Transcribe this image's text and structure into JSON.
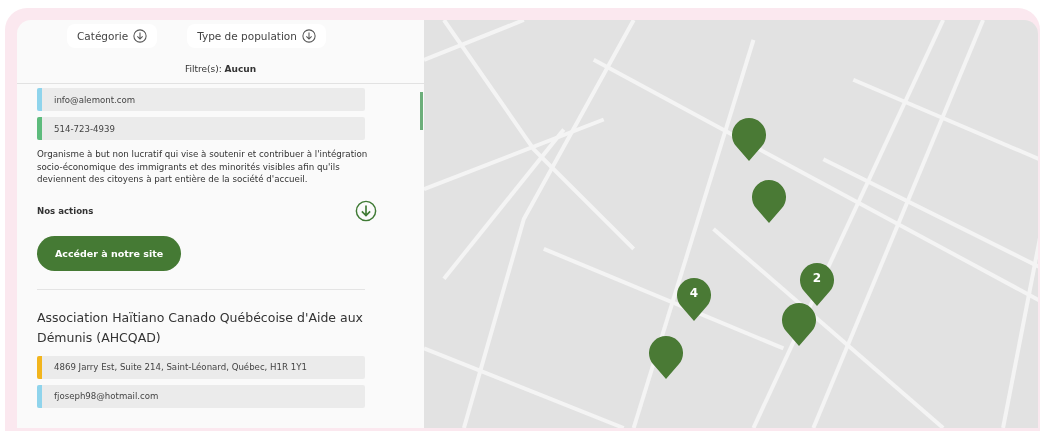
{
  "filters": [
    {
      "label": "Catégorie"
    },
    {
      "label": "Type de population"
    }
  ],
  "active_filters": {
    "label": "Filtre(s):",
    "value": "Aucun"
  },
  "organizations": [
    {
      "contacts": [
        {
          "text": "info@alemont.com",
          "color": "#8fd4ec"
        },
        {
          "text": "514-723-4939",
          "color": "#5dbb7c"
        }
      ],
      "description": "Organisme à but non lucratif qui vise à soutenir et contribuer à l'intégration socio-économique des immigrants et des minorités visibles afin qu'ils deviennent des citoyens à part entière de la société d'accueil.",
      "actions_label": "Nos actions",
      "button": "Accéder à notre site"
    },
    {
      "name": "Association Haïtiano Canado Québécoise d'Aide aux Démunis (AHCQAD)",
      "contacts": [
        {
          "text": "4869 Jarry Est, Suite 214, Saint-Léonard, Québec, H1R 1Y1",
          "color": "#f2b51d"
        },
        {
          "text": "fjoseph98@hotmail.com",
          "color": "#8fd4ec"
        }
      ]
    }
  ],
  "map": {
    "markers": [
      {
        "kind": "single"
      },
      {
        "kind": "single"
      },
      {
        "kind": "cluster",
        "count": "4"
      },
      {
        "kind": "cluster",
        "count": "2"
      },
      {
        "kind": "single"
      },
      {
        "kind": "single"
      }
    ]
  }
}
